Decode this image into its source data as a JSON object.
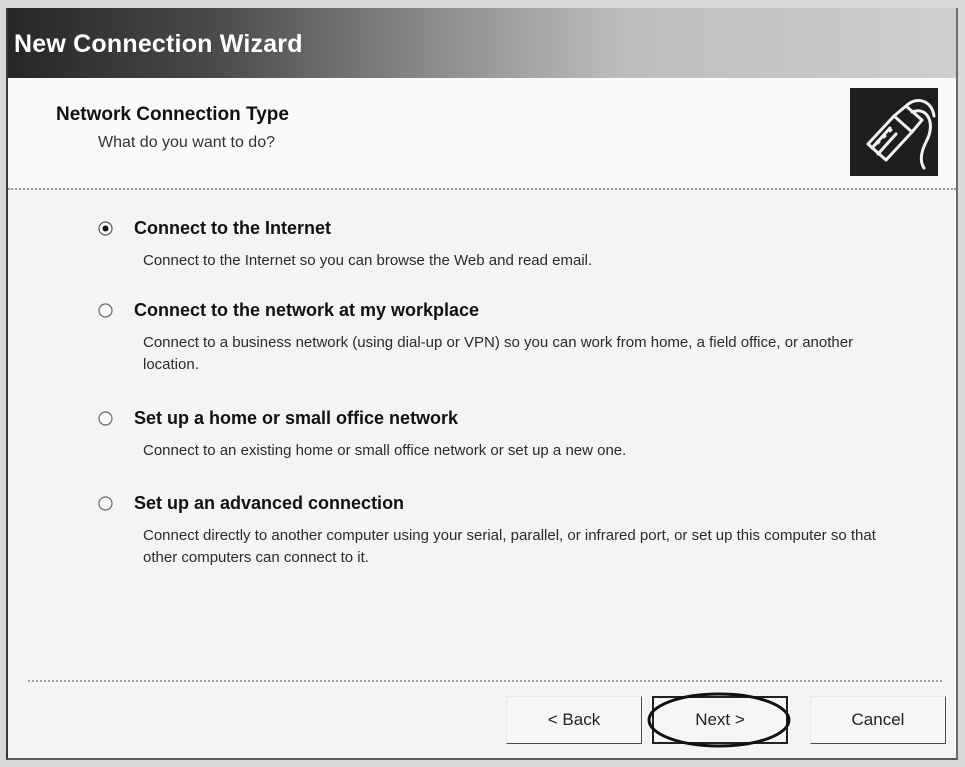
{
  "window": {
    "title": "New Connection Wizard"
  },
  "header": {
    "title": "Network Connection Type",
    "subtitle": "What do you want to do?",
    "icon": "network-cable-icon"
  },
  "options": [
    {
      "label": "Connect to the Internet",
      "description": "Connect to the Internet so you can browse the Web and read email.",
      "selected": true
    },
    {
      "label": "Connect to the network at my workplace",
      "description": "Connect to a business network (using dial-up or VPN) so you can work from home, a field office, or another location.",
      "selected": false
    },
    {
      "label": "Set up a home or small office network",
      "description": "Connect to an existing home or small office network or set up a new one.",
      "selected": false
    },
    {
      "label": "Set up an advanced connection",
      "description": "Connect directly to another computer using your serial, parallel, or infrared port, or set up this computer so that other computers can connect to it.",
      "selected": false
    }
  ],
  "buttons": {
    "back": "< Back",
    "next": "Next >",
    "cancel": "Cancel"
  }
}
